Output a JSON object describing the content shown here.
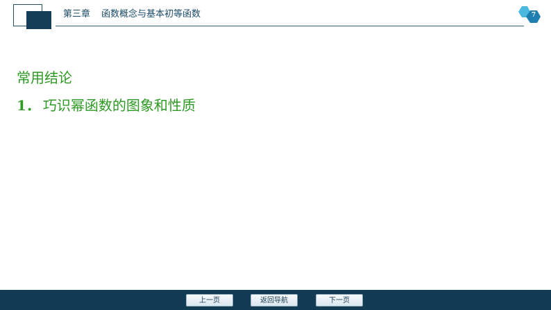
{
  "header": {
    "chapter": "第三章",
    "title": "函数概念与基本初等函数"
  },
  "page": {
    "number": "7"
  },
  "content": {
    "section_title": "常用结论",
    "item_number": "1．",
    "item_text": "巧识幂函数的图象和性质"
  },
  "footer": {
    "prev_label": "上一页",
    "home_label": "返回导航",
    "next_label": "下一页"
  },
  "colors": {
    "accent": "#2e9a24",
    "brand": "#143c56",
    "badge": "#1ea3d3"
  }
}
